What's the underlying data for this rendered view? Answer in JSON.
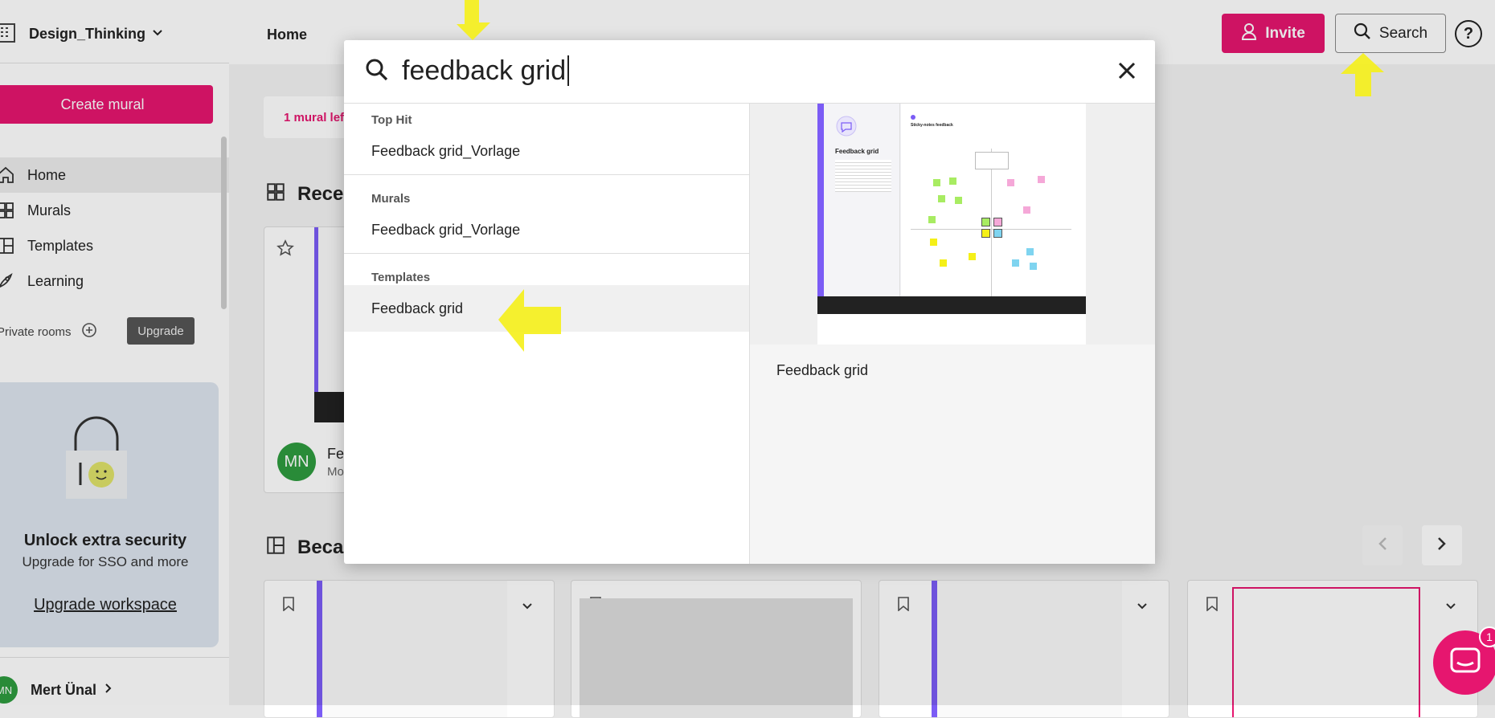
{
  "workspace": {
    "name": "Design_Thinking"
  },
  "sidebar": {
    "create_label": "Create mural",
    "items": [
      {
        "label": "Home",
        "icon": "home-icon"
      },
      {
        "label": "Murals",
        "icon": "grid-icon"
      },
      {
        "label": "Templates",
        "icon": "templates-icon"
      },
      {
        "label": "Learning",
        "icon": "rocket-icon"
      }
    ],
    "private_rooms_label": "Private rooms",
    "upgrade_badge": "Upgrade",
    "promo": {
      "title": "Unlock extra security",
      "subtitle": "Upgrade for SSO and more",
      "link": "Upgrade workspace"
    },
    "user": {
      "initials": "MN",
      "name": "Mert Ünal"
    }
  },
  "topbar": {
    "page_title": "Home",
    "invite_label": "Invite",
    "search_label": "Search",
    "help_label": "?"
  },
  "main": {
    "banner_text": "1 mural lef",
    "recent_heading": "Rece",
    "recent_card": {
      "avatar": "MN",
      "title": "Fe",
      "subtitle": "Mo"
    },
    "because_heading": "Beca"
  },
  "search_modal": {
    "query": "feedback grid",
    "sections": [
      {
        "heading": "Top Hit",
        "items": [
          "Feedback grid_Vorlage"
        ]
      },
      {
        "heading": "Murals",
        "items": [
          "Feedback grid_Vorlage"
        ]
      },
      {
        "heading": "Templates",
        "items": [
          "Feedback grid"
        ]
      }
    ],
    "preview_title": "Feedback grid",
    "preview_thumb": {
      "title": "Feedback grid",
      "header": "Sticky-notes feedback"
    }
  },
  "colors": {
    "brand_pink": "#e6166f",
    "sidebar_active": "#ececec",
    "promo_bg": "#dde5ef",
    "avatar_green": "#2e9b3f",
    "highlight_yellow": "#f5f018",
    "thumb_purple": "#7b5cf5"
  },
  "notification": {
    "count": "1"
  }
}
